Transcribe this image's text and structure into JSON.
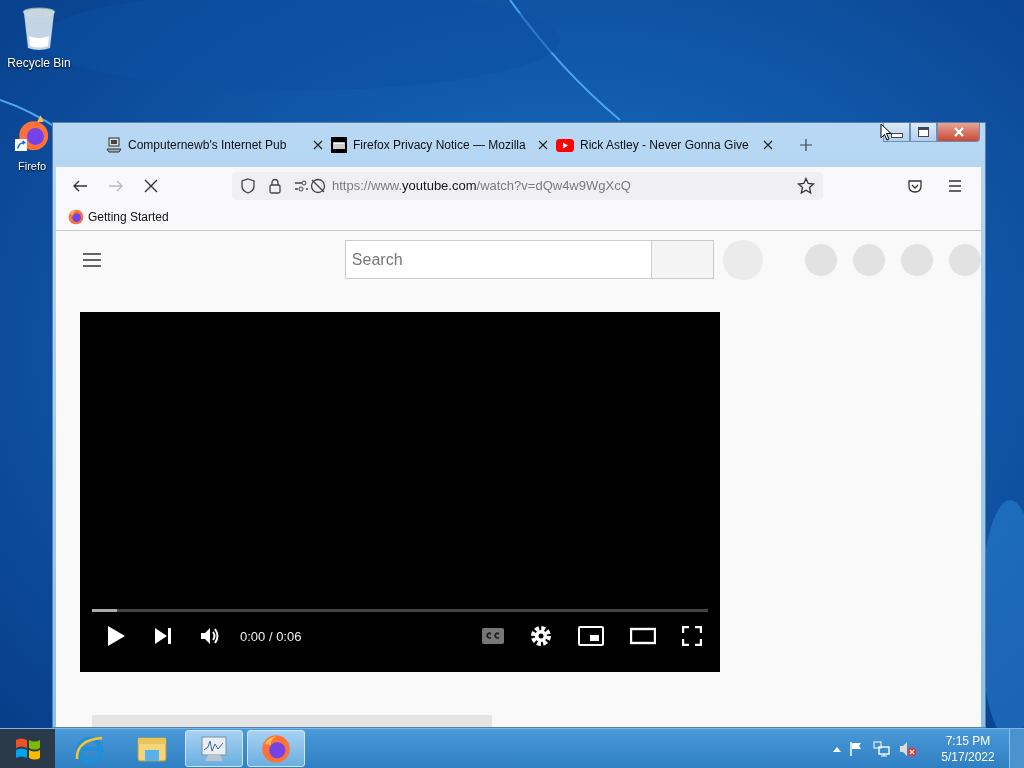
{
  "desktop_icons": [
    {
      "kind": "recycle",
      "label": "Recycle Bin"
    },
    {
      "kind": "firefox",
      "label": "Firefo"
    }
  ],
  "browser": {
    "tabs": [
      {
        "kind": "computer",
        "title": "Computernewb's Internet Pub"
      },
      {
        "kind": "mozilla",
        "title": "Firefox Privacy Notice — Mozilla"
      },
      {
        "kind": "youtube",
        "title": "Rick Astley - Never Gonna Give"
      }
    ],
    "url": {
      "scheme": "https://www.",
      "domain": "youtube.com",
      "path": "/watch?v=dQw4w9WgXcQ"
    },
    "bookmarks": [
      {
        "title": "Getting Started"
      }
    ]
  },
  "page": {
    "search": {
      "placeholder": "Search"
    },
    "player": {
      "level": 0.04,
      "time": "0:00 / 0:06"
    }
  },
  "taskbar": {
    "apps": [
      {
        "kind": "ie",
        "running": false
      },
      {
        "kind": "explorer",
        "running": false
      },
      {
        "kind": "monitor",
        "running": true
      },
      {
        "kind": "firefox",
        "running": true
      }
    ],
    "clock": {
      "time": "7:15 PM",
      "date": "5/17/2022"
    }
  }
}
